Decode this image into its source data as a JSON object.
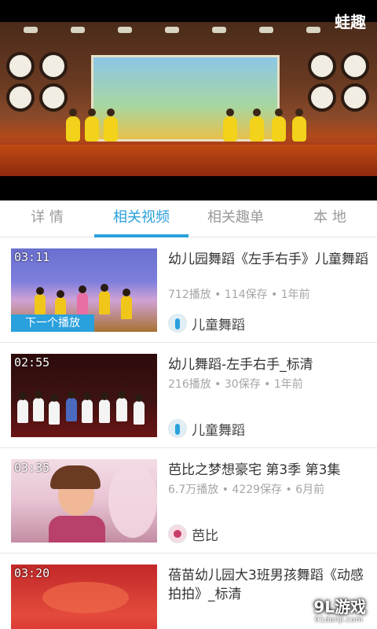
{
  "player": {
    "watermark": "蛙趣"
  },
  "tabs": [
    {
      "label": "详 情"
    },
    {
      "label": "相关视频"
    },
    {
      "label": "相关趣单"
    },
    {
      "label": "本 地"
    }
  ],
  "active_tab_index": 1,
  "videos": [
    {
      "duration": "03:11",
      "title": "幼儿园舞蹈《左手右手》儿童舞蹈",
      "meta": "712播放 • 114保存 • 1年前",
      "author": "儿童舞蹈",
      "badge": "下一个播放"
    },
    {
      "duration": "02:55",
      "title": "幼儿舞蹈-左手右手_标清",
      "meta": "216播放 • 30保存 • 1年前",
      "author": "儿童舞蹈"
    },
    {
      "duration": "03:35",
      "title": "芭比之梦想豪宅 第3季 第3集",
      "meta": "6.7万播放 • 4229保存 • 6月前",
      "author": "芭比"
    },
    {
      "duration": "03:20",
      "title": "蓓苗幼儿园大3班男孩舞蹈《动感拍拍》_标清"
    }
  ],
  "logo": {
    "text": "9L游戏",
    "sub": "91danji.com"
  },
  "colors": {
    "accent": "#2aa0dc"
  }
}
